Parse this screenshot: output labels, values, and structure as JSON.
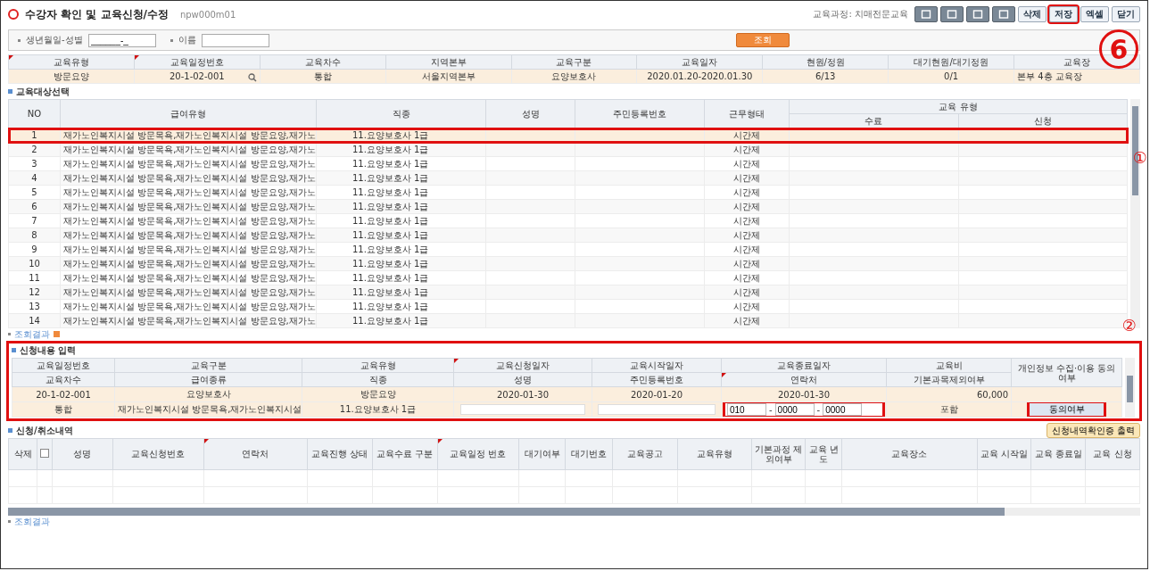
{
  "window": {
    "title": "수강자 확인 및 교육신청/수정",
    "screen_code": "npw000m01"
  },
  "toolbar": {
    "caption": "교육과정: 치매전문교육",
    "buttons": [
      {
        "label": "삭제",
        "highlighted": false
      },
      {
        "label": "저장",
        "highlighted": true
      },
      {
        "label": "엑셀",
        "highlighted": false
      },
      {
        "label": "닫기",
        "highlighted": false
      }
    ]
  },
  "search": {
    "fields": [
      {
        "label": "생년월일-성별",
        "value": "______-_"
      },
      {
        "label": "이름"
      }
    ],
    "button": "조회"
  },
  "schedule": {
    "columns": [
      {
        "label": "교육유형",
        "required": true
      },
      {
        "label": "교육일정번호",
        "required": true
      },
      {
        "label": "교육차수",
        "required": false
      },
      {
        "label": "지역본부",
        "required": false
      },
      {
        "label": "교육구분",
        "required": false
      },
      {
        "label": "교육일자",
        "required": false
      },
      {
        "label": "현원/정원",
        "required": false
      },
      {
        "label": "대기현원/대기정원",
        "required": false
      },
      {
        "label": "교육장",
        "required": false
      }
    ],
    "values": [
      "방문요양",
      "20-1-02-001",
      "통합",
      "서울지역본부",
      "요양보호사",
      "2020.01.20-2020.01.30",
      "6/13",
      "0/1",
      "본부 4층 교육장"
    ]
  },
  "target_section": {
    "title": "교육대상선택",
    "columns": [
      "NO",
      "급여유형",
      "직종",
      "성명",
      "주민등록번호",
      "근무형태"
    ],
    "group_header": "교육 유형",
    "subcolumns": [
      "수료",
      "신청"
    ],
    "rows": [
      {
        "no": "1",
        "pay_type": "재가노인복지시설 방문목욕,재가노인복지시설 방문요양,재가노",
        "job": "11.요양보호사 1급",
        "work_type": "시간제",
        "selected": true,
        "highlighted": true
      },
      {
        "no": "2",
        "pay_type": "재가노인복지시설 방문목욕,재가노인복지시설 방문요양,재가노",
        "job": "11.요양보호사 1급",
        "work_type": "시간제",
        "selected": false,
        "highlighted": false
      },
      {
        "no": "3",
        "pay_type": "재가노인복지시설 방문목욕,재가노인복지시설 방문요양,재가노",
        "job": "11.요양보호사 1급",
        "work_type": "시간제",
        "selected": false,
        "highlighted": false
      },
      {
        "no": "4",
        "pay_type": "재가노인복지시설 방문목욕,재가노인복지시설 방문요양,재가노",
        "job": "11.요양보호사 1급",
        "work_type": "시간제",
        "selected": false,
        "highlighted": false
      },
      {
        "no": "5",
        "pay_type": "재가노인복지시설 방문목욕,재가노인복지시설 방문요양,재가노",
        "job": "11.요양보호사 1급",
        "work_type": "시간제",
        "selected": false,
        "highlighted": false
      },
      {
        "no": "6",
        "pay_type": "재가노인복지시설 방문목욕,재가노인복지시설 방문요양,재가노",
        "job": "11.요양보호사 1급",
        "work_type": "시간제",
        "selected": false,
        "highlighted": false
      },
      {
        "no": "7",
        "pay_type": "재가노인복지시설 방문목욕,재가노인복지시설 방문요양,재가노",
        "job": "11.요양보호사 1급",
        "work_type": "시간제",
        "selected": false,
        "highlighted": false
      },
      {
        "no": "8",
        "pay_type": "재가노인복지시설 방문목욕,재가노인복지시설 방문요양,재가노",
        "job": "11.요양보호사 1급",
        "work_type": "시간제",
        "selected": false,
        "highlighted": false
      },
      {
        "no": "9",
        "pay_type": "재가노인복지시설 방문목욕,재가노인복지시설 방문요양,재가노",
        "job": "11.요양보호사 1급",
        "work_type": "시간제",
        "selected": false,
        "highlighted": false
      },
      {
        "no": "10",
        "pay_type": "재가노인복지시설 방문목욕,재가노인복지시설 방문요양,재가노",
        "job": "11.요양보호사 1급",
        "work_type": "시간제",
        "selected": false,
        "highlighted": false
      },
      {
        "no": "11",
        "pay_type": "재가노인복지시설 방문목욕,재가노인복지시설 방문요양,재가노",
        "job": "11.요양보호사 1급",
        "work_type": "시간제",
        "selected": false,
        "highlighted": false
      },
      {
        "no": "12",
        "pay_type": "재가노인복지시설 방문목욕,재가노인복지시설 방문요양,재가노",
        "job": "11.요양보호사 1급",
        "work_type": "시간제",
        "selected": false,
        "highlighted": false
      },
      {
        "no": "13",
        "pay_type": "재가노인복지시설 방문목욕,재가노인복지시설 방문요양,재가노",
        "job": "11.요양보호사 1급",
        "work_type": "시간제",
        "selected": false,
        "highlighted": false
      },
      {
        "no": "14",
        "pay_type": "재가노인복지시설 방문목욕,재가노인복지시설 방문요양,재가노",
        "job": "11.요양보호사 1급",
        "work_type": "시간제",
        "selected": false,
        "highlighted": false
      }
    ],
    "result_label": "조회결과"
  },
  "input_section": {
    "title": "신청내용 입력",
    "highlighted": true,
    "header_rows": [
      [
        {
          "label": "교육일정번호",
          "required": false
        },
        {
          "label": "교육구분",
          "required": false
        },
        {
          "label": "교육유형",
          "required": false
        },
        {
          "label": "교육신청일자",
          "required": true
        },
        {
          "label": "교육시작일자",
          "required": false
        },
        {
          "label": "교육종료일자",
          "required": false
        },
        {
          "label": "교육비",
          "required": false
        }
      ],
      [
        {
          "label": "교육차수",
          "required": false
        },
        {
          "label": "급여종류",
          "required": false
        },
        {
          "label": "직종",
          "required": false
        },
        {
          "label": "성명",
          "required": false
        },
        {
          "label": "주민등록번호",
          "required": false
        },
        {
          "label": "연락처",
          "required": true
        },
        {
          "label": "기본과목제외여부",
          "required": false
        }
      ]
    ],
    "consent_header": "개인정보 수집·이용 동의여부",
    "values_1": [
      "20-1-02-001",
      "요양보호사",
      "방문요양",
      "2020-01-30",
      "2020-01-20",
      "2020-01-30",
      "60,000"
    ],
    "values_2": [
      "통합",
      "재가노인복지시설 방문목욕,재가노인복지시설",
      "11.요양보호사 1급"
    ],
    "phone": {
      "parts": [
        "010",
        "0000",
        "0000"
      ],
      "separator": "-",
      "highlighted": true
    },
    "exclusion": "포함",
    "consent_button": {
      "label": "동의여부",
      "highlighted": true
    }
  },
  "history_section": {
    "title": "신청/취소내역",
    "print_button": "신청내역확인증 출력",
    "delete_header": "삭제",
    "select_all": {
      "checked": false
    },
    "columns": [
      {
        "label": "성명",
        "required": false
      },
      {
        "label": "교육신청번호",
        "required": false
      },
      {
        "label": "연락처",
        "required": true
      },
      {
        "label": "교육진행 상태",
        "required": false
      },
      {
        "label": "교육수료 구분",
        "required": false
      },
      {
        "label": "교육일정 번호",
        "required": true
      },
      {
        "label": "대기여부",
        "required": false
      },
      {
        "label": "대기번호",
        "required": false
      },
      {
        "label": "교육공고",
        "required": false
      },
      {
        "label": "교육유형",
        "required": false
      },
      {
        "label": "기본과정 제외여부",
        "required": false
      },
      {
        "label": "교육 년도",
        "required": false
      },
      {
        "label": "교육장소",
        "required": false
      },
      {
        "label": "교육 시작일",
        "required": false
      },
      {
        "label": "교육 종료일",
        "required": false
      },
      {
        "label": "교육 신청",
        "required": false
      }
    ],
    "result_label": "조회결과"
  },
  "annotations": {
    "step": "6",
    "marker_1": "①",
    "marker_2": "②"
  }
}
